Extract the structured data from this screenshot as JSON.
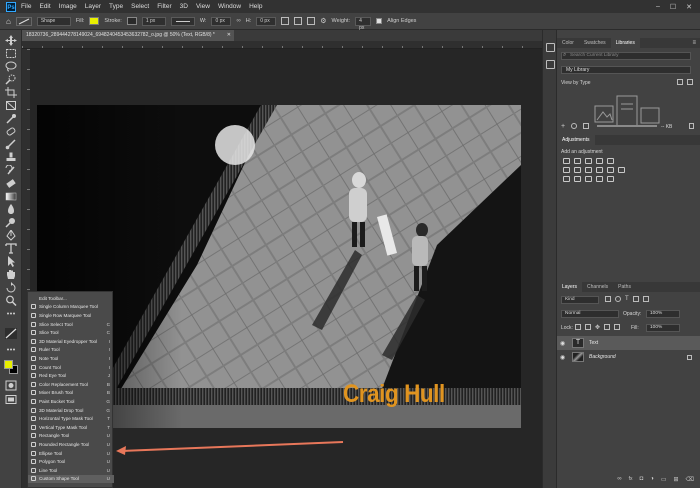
{
  "menubar": {
    "app_icon": "Ps",
    "items": [
      "File",
      "Edit",
      "Image",
      "Layer",
      "Type",
      "Select",
      "Filter",
      "3D",
      "View",
      "Window",
      "Help"
    ]
  },
  "options_bar": {
    "mode": "Shape",
    "fill_label": "Fill:",
    "fill_color": "#e8ef00",
    "stroke_label": "Stroke:",
    "stroke_width": "1 px",
    "w_label": "W:",
    "w_value": "0 px",
    "h_label": "H:",
    "h_value": "0 px",
    "weight_label": "Weight:",
    "weight_value": "4 px",
    "align_edges_label": "Align Edges"
  },
  "document": {
    "tab_title": "18320736_289444278149024_6948240453453632782_o.jpg @ 50% (Text, RGB/8) *",
    "brand_text": "Craig Hull",
    "brand_color": "#e09420"
  },
  "flyout": {
    "items": [
      {
        "label": "Edit Toolbar...",
        "key": ""
      },
      {
        "label": "Single Column Marquee Tool",
        "key": ""
      },
      {
        "label": "Single Row Marquee Tool",
        "key": ""
      },
      {
        "label": "Slice Select Tool",
        "key": "C"
      },
      {
        "label": "Slice Tool",
        "key": "C"
      },
      {
        "label": "3D Material Eyedropper Tool",
        "key": "I"
      },
      {
        "label": "Ruler Tool",
        "key": "I"
      },
      {
        "label": "Note Tool",
        "key": "I"
      },
      {
        "label": "Count Tool",
        "key": "I"
      },
      {
        "label": "Red Eye Tool",
        "key": "J"
      },
      {
        "label": "Color Replacement Tool",
        "key": "B"
      },
      {
        "label": "Mixer Brush Tool",
        "key": "B"
      },
      {
        "label": "Paint Bucket Tool",
        "key": "G"
      },
      {
        "label": "3D Material Drop Tool",
        "key": "G"
      },
      {
        "label": "Horizontal Type Mask Tool",
        "key": "T"
      },
      {
        "label": "Vertical Type Mask Tool",
        "key": "T"
      },
      {
        "label": "Rectangle Tool",
        "key": "U"
      },
      {
        "label": "Rounded Rectangle Tool",
        "key": "U"
      },
      {
        "label": "Ellipse Tool",
        "key": "U"
      },
      {
        "label": "Polygon Tool",
        "key": "U"
      },
      {
        "label": "Line Tool",
        "key": "U"
      },
      {
        "label": "Custom Shape Tool",
        "key": "U"
      }
    ]
  },
  "panels": {
    "top_tabs": [
      "Color",
      "Swatches",
      "Libraries"
    ],
    "libraries": {
      "search_placeholder": "Search Current Library",
      "library_name": "My Library",
      "view_by": "View by Type",
      "size": "-- KB"
    },
    "adjustments": {
      "tab": "Adjustments",
      "add_label": "Add an adjustment"
    },
    "layers": {
      "tabs": [
        "Layers",
        "Channels",
        "Paths"
      ],
      "kind_label": "Kind",
      "blend_mode": "Normal",
      "opacity_label": "Opacity:",
      "opacity_value": "100%",
      "lock_label": "Lock:",
      "fill_label": "Fill:",
      "fill_value": "100%",
      "rows": [
        {
          "name": "Text",
          "thumb": "T"
        },
        {
          "name": "Background",
          "thumb": ""
        }
      ]
    }
  },
  "colors": {
    "foreground": "#e8ef00",
    "background": "#000000",
    "arrow": "#e8775a"
  }
}
